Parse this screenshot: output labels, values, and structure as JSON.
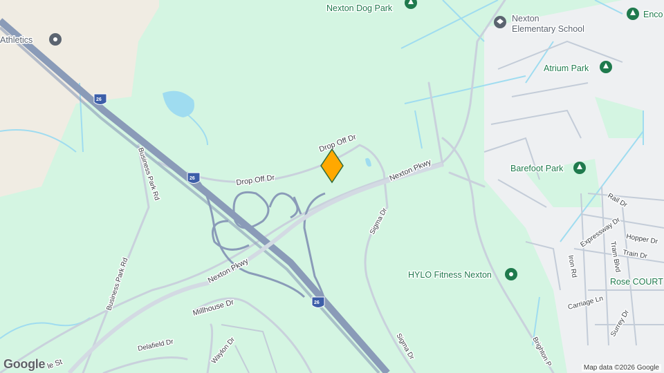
{
  "map": {
    "colors": {
      "park": "#d4f5e2",
      "land": "#f0ece3",
      "water": "#9fdcf0",
      "highway": "#8a9bb8",
      "road": "#c9d1dc",
      "poi_green": "#1f7a4d",
      "poi_gray": "#5b6470",
      "marker": "#ffa800"
    },
    "marker": {
      "icon": "map-pin-icon",
      "color": "#ffa800"
    },
    "pois": [
      {
        "name": "Nexton Dog Park",
        "icon": "park-tree-icon"
      },
      {
        "name": "Nexton",
        "line2": "Elementary School",
        "icon": "school-icon"
      },
      {
        "name": "Atrium Park",
        "icon": "park-tree-icon"
      },
      {
        "name": "Barefoot Park",
        "icon": "park-tree-icon"
      },
      {
        "name": "HYLO Fitness Nexton",
        "icon": "fitness-icon"
      },
      {
        "name": "Rose COURT"
      },
      {
        "name": "Athletics",
        "icon": "place-icon"
      },
      {
        "name": "Enco",
        "icon": "park-tree-icon"
      }
    ],
    "roads": {
      "drop_off_1": "Drop Off Dr",
      "drop_off_2": "Drop Off Dr",
      "nexton_pkwy_1": "Nexton Pkwy",
      "nexton_pkwy_2": "Nexton Pkwy",
      "sigma_1": "Sigma Dr",
      "sigma_2": "Sigma Dr",
      "business_park_1": "Business Park Rd",
      "business_park_2": "Business Park Rd",
      "millhouse": "Millhouse Dr",
      "delafield": "Delafield Dr",
      "waylon": "Waylon Dr",
      "brighton": "Brighton P",
      "iron": "Iron Rd",
      "rail": "Rail Dr",
      "expressway": "Expressway Dr",
      "hopper": "Hopper Dr",
      "train": "Train Dr",
      "tram": "Tram Blvd",
      "carriage": "Carriage Ln",
      "surrey": "Surrey Dr",
      "st": "le St"
    },
    "shields": [
      "26",
      "26",
      "26"
    ],
    "attribution": "Map data ©2026 Google",
    "logo": "Google"
  }
}
